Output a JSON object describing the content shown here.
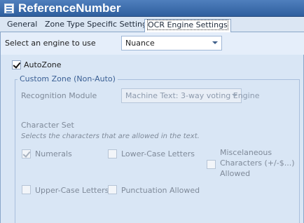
{
  "window": {
    "title": "ReferenceNumber",
    "icon": "form-icon"
  },
  "tabs": [
    {
      "label": "General",
      "active": false
    },
    {
      "label": "Zone Type Specific Settings",
      "active": false
    },
    {
      "label": "OCR Engine Settings",
      "active": true
    }
  ],
  "engine": {
    "label": "Select an engine to use",
    "selected": "Nuance"
  },
  "autozone": {
    "label": "AutoZone",
    "checked": true
  },
  "custom_zone": {
    "legend": "Custom Zone (Non-Auto)",
    "recognition_module": {
      "label": "Recognition Module",
      "selected": "Machine Text: 3-way voting Engine",
      "enabled": false
    },
    "character_set": {
      "heading": "Character Set",
      "hint": "Selects the characters that are allowed in the text.",
      "options": [
        {
          "label": "Numerals",
          "checked": true
        },
        {
          "label": "Lower-Case Letters",
          "checked": false
        },
        {
          "label_lines": [
            "Miscelaneous",
            "Characters (+/-$...)",
            "Allowed"
          ],
          "checked": false
        },
        {
          "label": "Upper-Case Letters",
          "checked": false
        },
        {
          "label": "Punctuation Allowed",
          "checked": false
        }
      ]
    }
  },
  "colors": {
    "title_bar": "#3f6fae",
    "tab_strip": "#dbe6f3",
    "panel": "#d9e6f5",
    "legend_text": "#3a5f94"
  }
}
